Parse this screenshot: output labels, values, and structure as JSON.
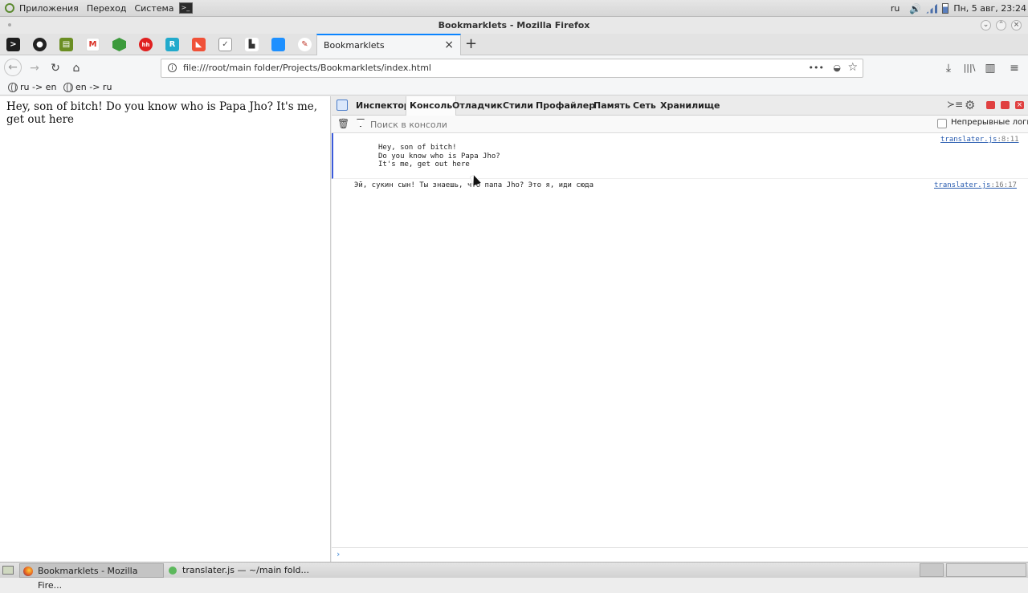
{
  "panel": {
    "menus": [
      "Приложения",
      "Переход",
      "Система"
    ],
    "lang": "ru",
    "clock": "Пн,  5 авг, 23:24"
  },
  "window": {
    "title": "Bookmarklets - Mozilla Firefox"
  },
  "tabs": {
    "active_title": "Bookmarklets",
    "pinned": [
      {
        "icon": "terminal-icon",
        "color": "#1e1e1e"
      },
      {
        "icon": "github-icon",
        "color": "#222222"
      },
      {
        "icon": "reader-icon",
        "color": "#6b8e23"
      },
      {
        "icon": "gmail-icon",
        "color": "#d93025"
      },
      {
        "icon": "hex-icon",
        "color": "#3c9a3c"
      },
      {
        "icon": "hh-icon",
        "color": "#e02020"
      },
      {
        "icon": "r-icon",
        "color": "#22aacc"
      },
      {
        "icon": "swift-icon",
        "color": "#f05138"
      },
      {
        "icon": "shield-icon",
        "color": "#555555"
      },
      {
        "icon": "chart-icon",
        "color": "#333333"
      },
      {
        "icon": "blue-icon",
        "color": "#1e90ff"
      },
      {
        "icon": "ext-icon",
        "color": "#c0392b"
      }
    ]
  },
  "navbar": {
    "url": "file:///root/main folder/Projects/Bookmarklets/index.html"
  },
  "bookmarks": [
    {
      "label": "ru -> en"
    },
    {
      "label": "en -> ru"
    }
  ],
  "page": {
    "text": "Hey, son of bitch! Do you know who is Papa Jho? It's me, get out here"
  },
  "devtools": {
    "tabs": [
      "Инспектор",
      "Консоль",
      "Отладчик",
      "Стили",
      "Профайлер",
      "Память",
      "Сеть",
      "Хранилище"
    ],
    "selected_tab": "Консоль",
    "filter_placeholder": "Поиск в консоли",
    "persist_logs_label": "Непрерывные логи",
    "messages": [
      {
        "text": "Hey, son of bitch!\nDo you know who is Papa Jho?\nIt's me, get out here",
        "source": "translater.js",
        "loc": ":8:11"
      },
      {
        "text": "Эй, сукин сын! Ты знаешь, что папа Jho? Это я, иди сюда",
        "source": "translater.js",
        "loc": ":16:17"
      }
    ],
    "prompt": "›"
  },
  "taskbar": {
    "items": [
      "Bookmarklets - Mozilla Fire...",
      "translater.js — ~/main fold..."
    ]
  },
  "colors": {
    "accent": "#0a84ff",
    "link": "#2a5db0",
    "selection_bar": "#3b5bdb"
  }
}
